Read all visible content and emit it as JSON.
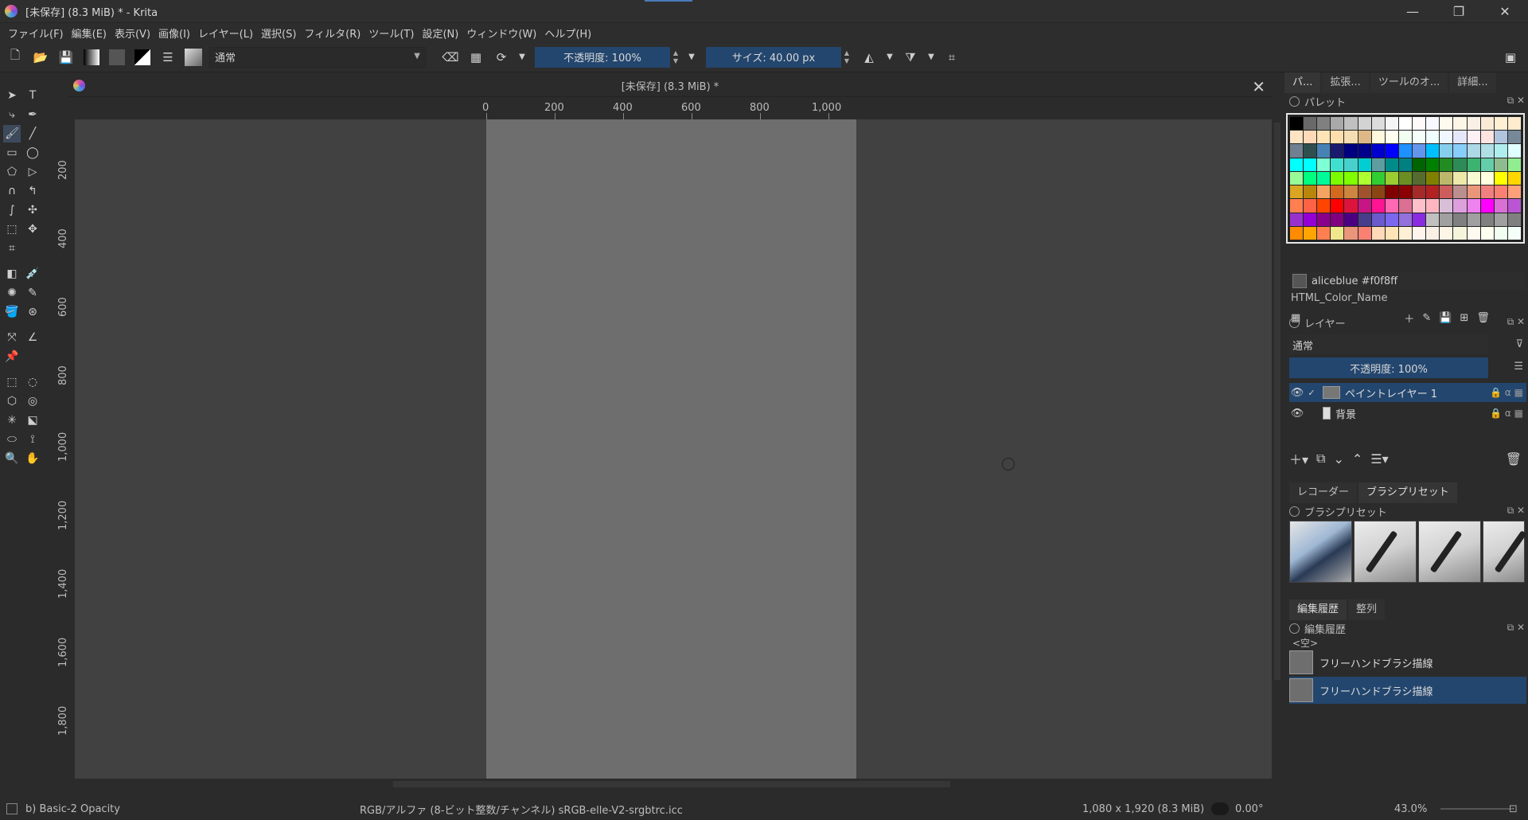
{
  "window": {
    "title": "[未保存]  (8.3 MiB) * - Krita",
    "buttons": {
      "minimize": "—",
      "restore": "❐",
      "close": "✕"
    }
  },
  "menu": [
    "ファイル(F)",
    "編集(E)",
    "表示(V)",
    "画像(I)",
    "レイヤー(L)",
    "選択(S)",
    "フィルタ(R)",
    "ツール(T)",
    "設定(N)",
    "ウィンドウ(W)",
    "ヘルプ(H)"
  ],
  "toolbar": {
    "blend_mode": "通常",
    "opacity": "不透明度: 100%",
    "size": "サイズ: 40.00 px"
  },
  "document": {
    "title": "[未保存]  (8.3 MiB) *"
  },
  "ruler_h": [
    "0",
    "200",
    "400",
    "600",
    "800",
    "1,000"
  ],
  "ruler_v": [
    "200",
    "400",
    "600",
    "800",
    "1,000",
    "1,200",
    "1,400",
    "1,600",
    "1,800"
  ],
  "dock": {
    "top_tabs": [
      "パ...",
      "拡張...",
      "ツールのオ...",
      "詳細..."
    ],
    "palette": {
      "title": "パレット",
      "selected_color": "aliceblue #f0f8ff",
      "palette_name": "HTML_Color_Name"
    },
    "layers": {
      "title": "レイヤー",
      "blend_mode": "通常",
      "opacity": "不透明度: 100%",
      "items": [
        {
          "name": "ペイントレイヤー 1",
          "selected": true
        },
        {
          "name": "背景",
          "selected": false
        }
      ]
    },
    "mid_tabs": [
      "レコーダー",
      "ブラシプリセット"
    ],
    "brush_presets": {
      "title": "ブラシプリセット"
    },
    "bottom_tabs": [
      "編集履歴",
      "整列"
    ],
    "history": {
      "title": "編集履歴",
      "empty_label": "<空>",
      "items": [
        "フリーハンドブラシ描線",
        "フリーハンドブラシ描線"
      ]
    }
  },
  "status": {
    "brush": "b) Basic-2 Opacity",
    "color_space": "RGB/アルファ (8-ビット整数/チャンネル)  sRGB-elle-V2-srgbtrc.icc",
    "dimensions": "1,080 x 1,920 (8.3 MiB)",
    "rotation": "0.00°",
    "zoom": "43.0%"
  },
  "palette_colors": [
    "#000000",
    "#696969",
    "#808080",
    "#a9a9a9",
    "#c0c0c0",
    "#d3d3d3",
    "#dcdcdc",
    "#f5f5f5",
    "#ffffff",
    "#fffafa",
    "#f8f8ff",
    "#fffaf0",
    "#fdf5e6",
    "#faf0e6",
    "#faebd7",
    "#ffefd5",
    "#ffebcd",
    "#ffe4c4",
    "#ffdab9",
    "#ffe4b5",
    "#ffdead",
    "#f5deb3",
    "#deb887",
    "#fff8dc",
    "#fffff0",
    "#f0fff0",
    "#f5fffa",
    "#f0ffff",
    "#f0f8ff",
    "#e6e6fa",
    "#fff0f5",
    "#ffe4e1",
    "#b0c4de",
    "#778899",
    "#708090",
    "#2f4f4f",
    "#4682b4",
    "#191970",
    "#000080",
    "#00008b",
    "#0000cd",
    "#0000ff",
    "#1e90ff",
    "#6495ed",
    "#00bfff",
    "#87ceeb",
    "#87cefa",
    "#add8e6",
    "#b0e0e6",
    "#afeeee",
    "#e0ffff",
    "#00ffff",
    "#00ffff",
    "#7fffd4",
    "#40e0d0",
    "#48d1cc",
    "#00ced1",
    "#5f9ea0",
    "#008b8b",
    "#008080",
    "#006400",
    "#008000",
    "#228b22",
    "#2e8b57",
    "#3cb371",
    "#66cdaa",
    "#8fbc8f",
    "#90ee90",
    "#98fb98",
    "#00ff7f",
    "#00fa9a",
    "#7cfc00",
    "#7fff00",
    "#adff2f",
    "#32cd32",
    "#9acd32",
    "#6b8e23",
    "#556b2f",
    "#808000",
    "#bdb76b",
    "#eee8aa",
    "#fafad2",
    "#ffffe0",
    "#ffff00",
    "#ffd700",
    "#daa520",
    "#b8860b",
    "#f4a460",
    "#d2691e",
    "#cd853f",
    "#a0522d",
    "#8b4513",
    "#800000",
    "#8b0000",
    "#a52a2a",
    "#b22222",
    "#cd5c5c",
    "#bc8f8f",
    "#e9967a",
    "#f08080",
    "#fa8072",
    "#ffa07a",
    "#ff7f50",
    "#ff6347",
    "#ff4500",
    "#ff0000",
    "#dc143c",
    "#c71585",
    "#ff1493",
    "#ff69b4",
    "#db7093",
    "#ffc0cb",
    "#ffb6c1",
    "#d8bfd8",
    "#dda0dd",
    "#ee82ee",
    "#ff00ff",
    "#da70d6",
    "#ba55d3",
    "#9932cc",
    "#9400d3",
    "#8b008b",
    "#800080",
    "#4b0082",
    "#483d8b",
    "#6a5acd",
    "#7b68ee",
    "#9370db",
    "#8a2be2",
    "#c0c0c0",
    "#a0a0a0",
    "#808080",
    "#a0a0a0",
    "#808080",
    "#a0a0a0",
    "#808080",
    "#ff8c00",
    "#ffa500",
    "#ff7f50",
    "#f0e68c",
    "#e9967a",
    "#fa8072",
    "#ffdab9",
    "#ffe4b5",
    "#ffefd5",
    "#fff5ee",
    "#faf0e6",
    "#fdf5e6",
    "#f5f5dc",
    "#fffaf0",
    "#fffff0",
    "#f0fff0",
    "#f5fffa"
  ]
}
